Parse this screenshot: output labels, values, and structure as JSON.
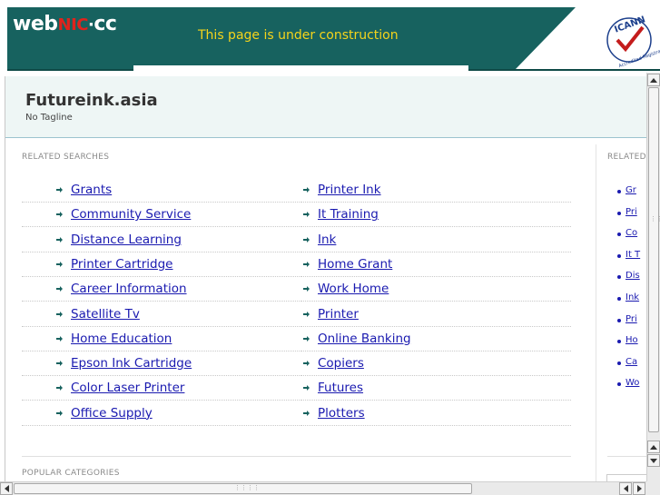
{
  "banner": {
    "logo_web": "web",
    "logo_nic": "NIC",
    "logo_dot": "·",
    "logo_cc": "cc",
    "message": "This page is under construction",
    "icann_badge_text": "ICANN",
    "icann_subtext": "Accredited Registrar",
    "colors": {
      "bar": "#17625f",
      "message": "#f5d41b",
      "nic_red": "#e0231c"
    }
  },
  "site": {
    "title": "Futureink.asia",
    "tagline": "No Tagline"
  },
  "related_searches": {
    "label": "RELATED SEARCHES",
    "left_column": [
      "Grants",
      "Community Service",
      "Distance Learning",
      "Printer Cartridge",
      "Career Information",
      "Satellite Tv",
      "Home Education",
      "Epson Ink Cartridge",
      "Color Laser Printer",
      "Office Supply"
    ],
    "right_column": [
      "Printer Ink",
      "It Training",
      "Ink",
      "Home Grant",
      "Work Home",
      "Printer",
      "Online Banking",
      "Copiers",
      "Futures",
      "Plotters"
    ]
  },
  "related_side": {
    "label": "RELATED",
    "items": [
      "Gr",
      "Pri",
      "Co",
      "It T",
      "Dis",
      "Ink",
      "Pri",
      "Ho",
      "Ca",
      "Wo"
    ]
  },
  "popular_categories": {
    "label": "POPULAR CATEGORIES"
  }
}
